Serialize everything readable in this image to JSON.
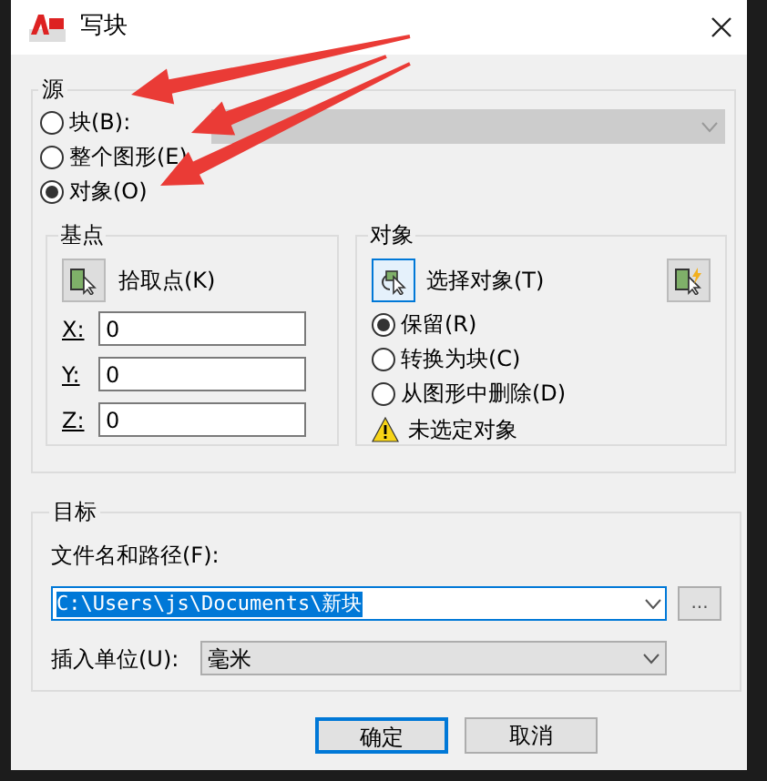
{
  "window": {
    "title": "写块"
  },
  "source": {
    "title": "源",
    "block_dropdown": {
      "disabled": true
    },
    "options": [
      {
        "label": "块(B):",
        "selected": false
      },
      {
        "label": "整个图形(E)",
        "selected": false
      },
      {
        "label": "对象(O)",
        "selected": true
      }
    ]
  },
  "base_point": {
    "title": "基点",
    "pick_button": "拾取点(K)",
    "fields": [
      {
        "label": "X:",
        "value": "0"
      },
      {
        "label": "Y:",
        "value": "0"
      },
      {
        "label": "Z:",
        "value": "0"
      }
    ]
  },
  "objects": {
    "title": "对象",
    "select_button": "选择对象(T)",
    "options": [
      {
        "label": "保留(R)",
        "selected": true
      },
      {
        "label": "转换为块(C)",
        "selected": false
      },
      {
        "label": "从图形中删除(D)",
        "selected": false
      }
    ],
    "warning": "未选定对象"
  },
  "destination": {
    "title": "目标",
    "file_label": "文件名和路径(F):",
    "file_path": "C:\\Users\\js\\Documents\\新块",
    "browse_button": "...",
    "units_label": "插入单位(U):",
    "units": "毫米"
  },
  "buttons": [
    {
      "label": "确定",
      "default": true
    },
    {
      "label": "取消",
      "default": false
    }
  ]
}
